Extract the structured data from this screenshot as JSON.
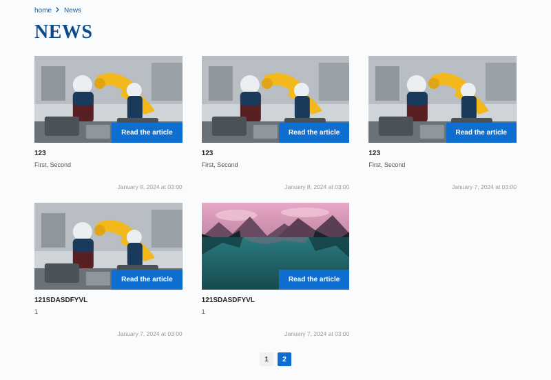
{
  "breadcrumb": {
    "home": "home",
    "current": "News"
  },
  "page_title": "NEWS",
  "read_button_label": "Read the article",
  "articles": [
    {
      "title": "123",
      "tags": "First, Second",
      "date": "January 8, 2024 at 03:00",
      "img": "factory"
    },
    {
      "title": "123",
      "tags": "First, Second",
      "date": "January 8, 2024 at 03:00",
      "img": "factory"
    },
    {
      "title": "123",
      "tags": "First, Second",
      "date": "January 7, 2024 at 03:00",
      "img": "factory"
    },
    {
      "title": "121SDASDFYVL",
      "tags": "1",
      "date": "January 7, 2024 at 03:00",
      "img": "factory"
    },
    {
      "title": "121SDASDFYVL",
      "tags": "1",
      "date": "January 7, 2024 at 03:00",
      "img": "lake"
    }
  ],
  "pagination": {
    "pages": [
      "1",
      "2"
    ],
    "active": "2"
  }
}
